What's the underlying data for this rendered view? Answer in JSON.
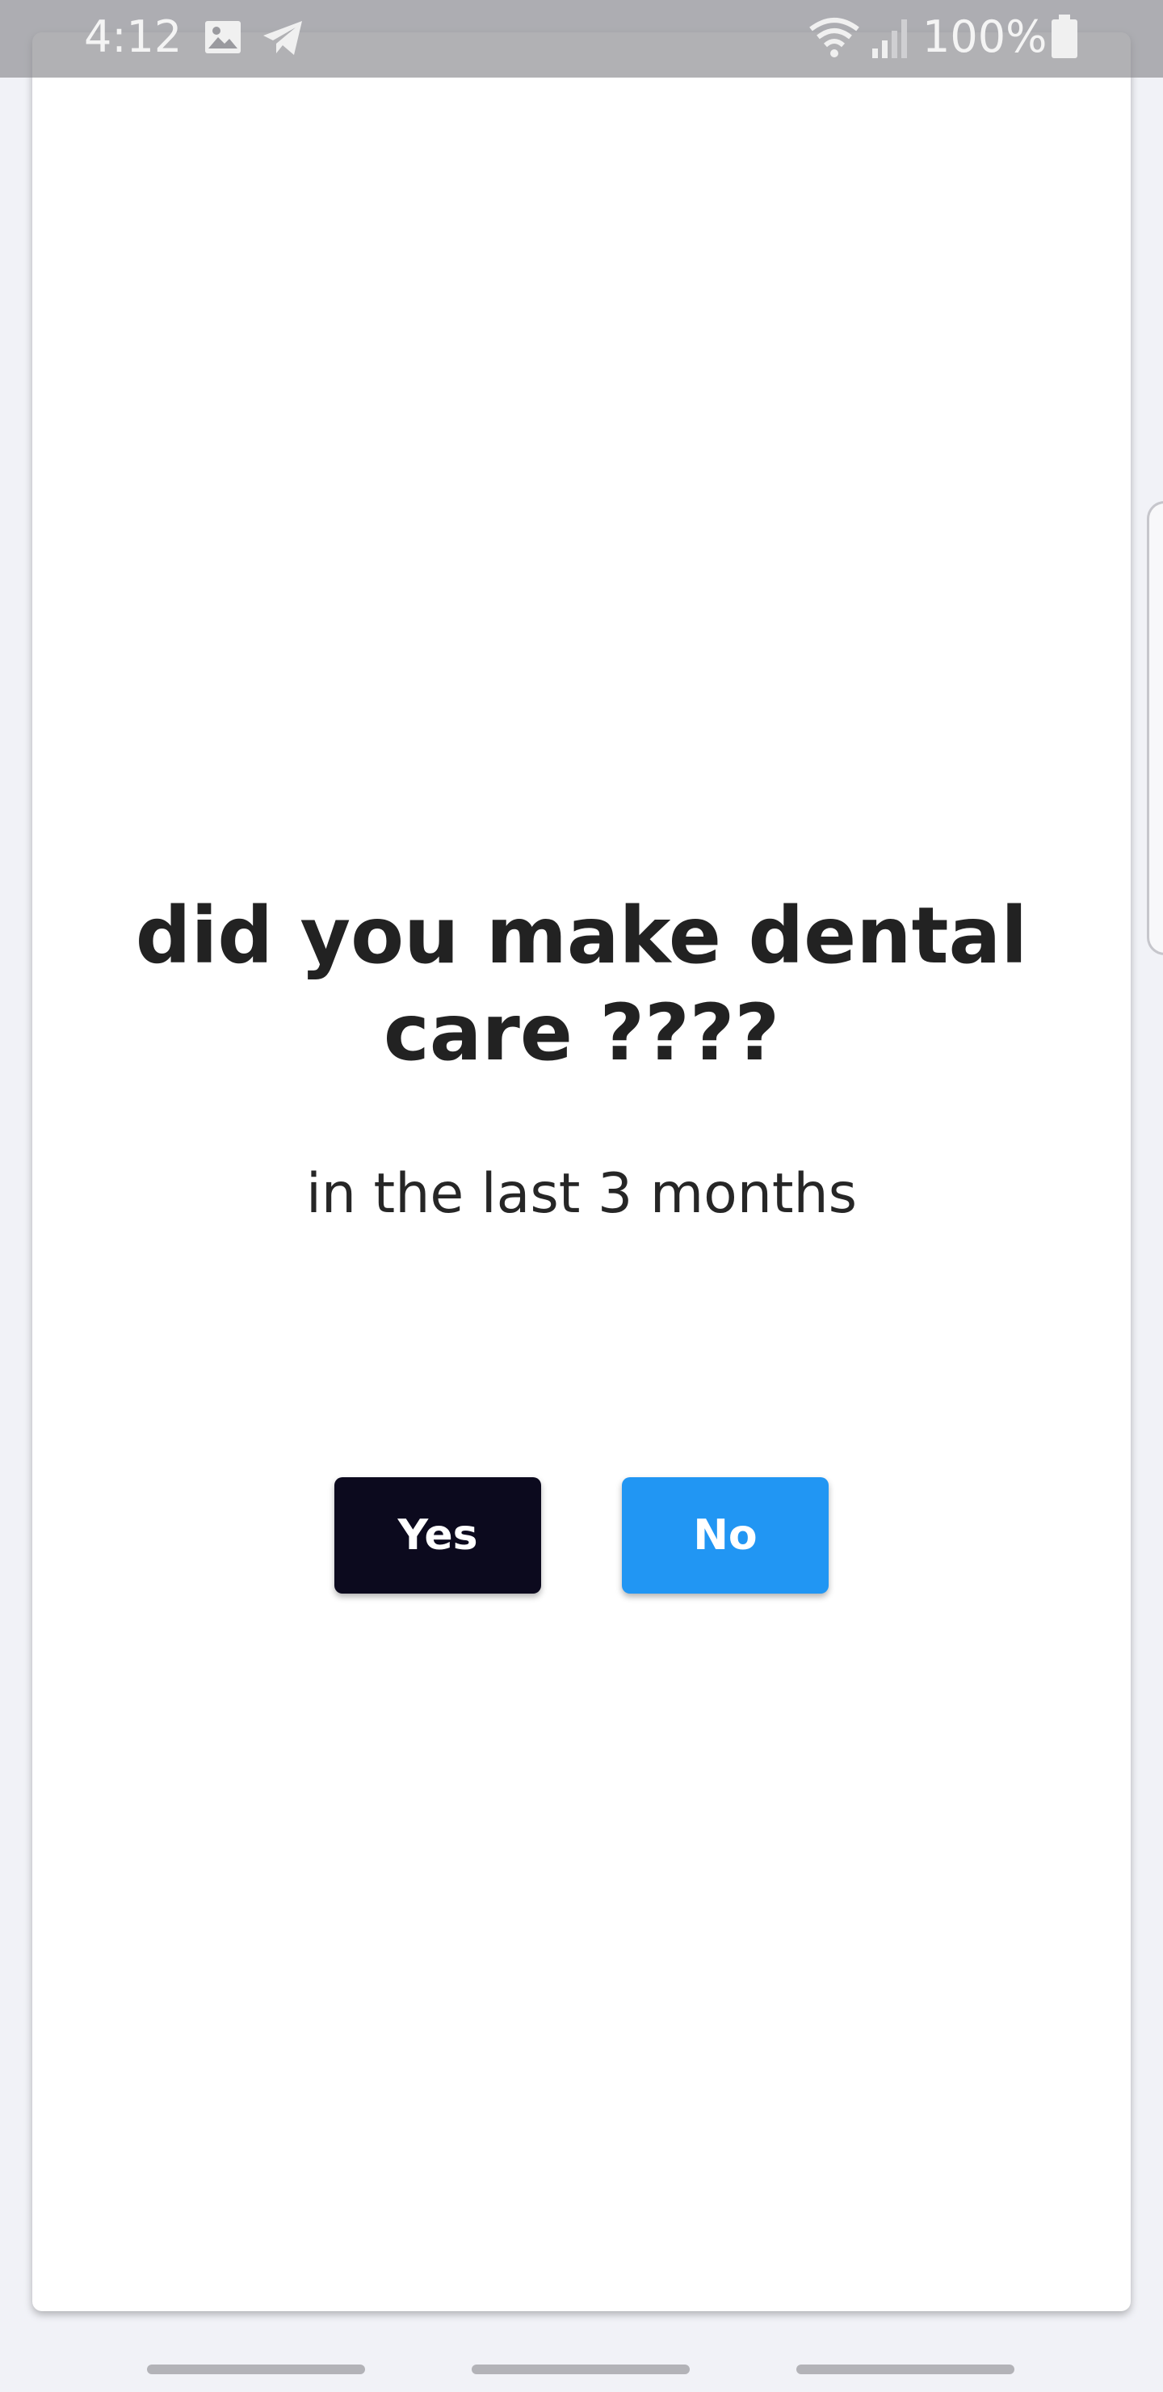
{
  "status_bar": {
    "time": "4:12",
    "battery_text": "100%",
    "icons": [
      "image-icon",
      "telegram-icon",
      "wifi-icon",
      "signal-icon",
      "battery-icon"
    ]
  },
  "question": {
    "title": "did you make dental care ????",
    "subtitle": "in the last 3 months"
  },
  "actions": {
    "yes_label": "Yes",
    "no_label": "No"
  },
  "colors": {
    "yes_button": "#0c0a1e",
    "no_button": "#2196f3",
    "title_text": "#222222",
    "page_background": "#f1f2f7",
    "card_background": "#ffffff"
  },
  "nav_bar": {
    "items": [
      "recent-apps",
      "home",
      "back"
    ]
  }
}
